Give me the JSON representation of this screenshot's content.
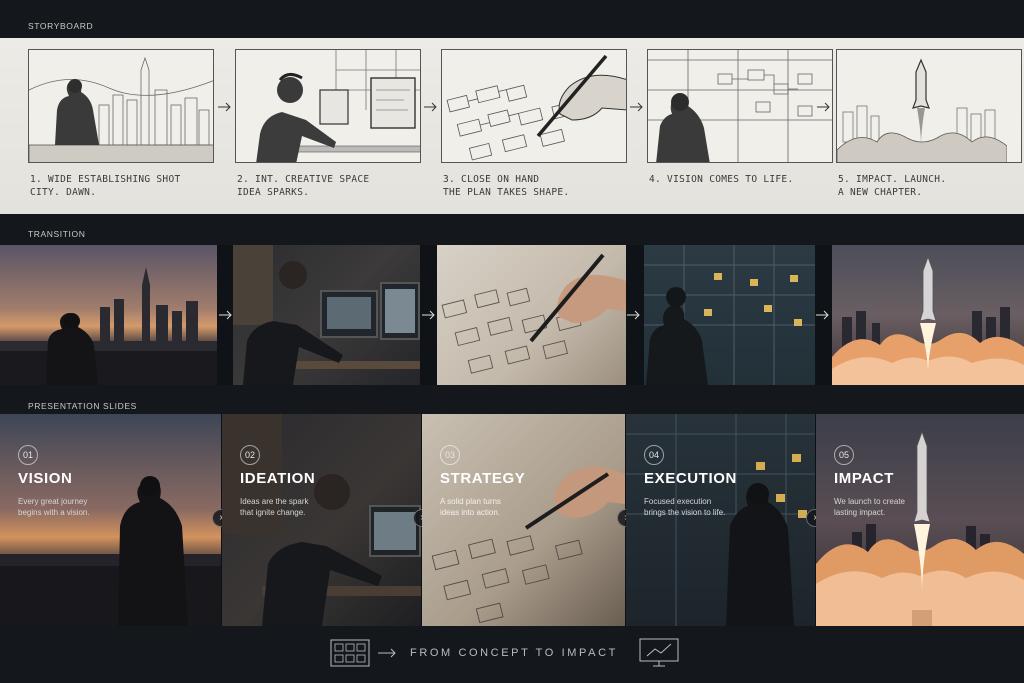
{
  "sections": {
    "storyboard": "STORYBOARD",
    "transition": "TRANSITION",
    "slides": "PRESENTATION SLIDES"
  },
  "storyboard": [
    {
      "caption": "1. Wide establishing shot\ncity. dawn."
    },
    {
      "caption": "2. Int. creative space\nidea sparks."
    },
    {
      "caption": "3. Close on hand\nthe plan takes shape."
    },
    {
      "caption": "4. Vision comes to life."
    },
    {
      "caption": "5. Impact. launch.\na new chapter."
    }
  ],
  "slides": [
    {
      "num": "01",
      "title": "VISION",
      "text": "Every great journey\nbegins with a vision."
    },
    {
      "num": "02",
      "title": "IDEATION",
      "text": "Ideas are the spark\nthat ignite change."
    },
    {
      "num": "03",
      "title": "STRATEGY",
      "text": "A solid plan turns\nideas into action."
    },
    {
      "num": "04",
      "title": "EXECUTION",
      "text": "Focused execution\nbrings the vision to life."
    },
    {
      "num": "05",
      "title": "IMPACT",
      "text": "We launch to create\nlasting impact."
    }
  ],
  "footer": {
    "tagline": "FROM CONCEPT TO IMPACT",
    "left_icon": "storyboard-grid-icon",
    "right_icon": "presentation-chart-icon"
  },
  "colors": {
    "paper": "#ecebe6",
    "dark_bg": "#14171c",
    "dusk": "#d59a6a",
    "fire": "#f0b070"
  }
}
